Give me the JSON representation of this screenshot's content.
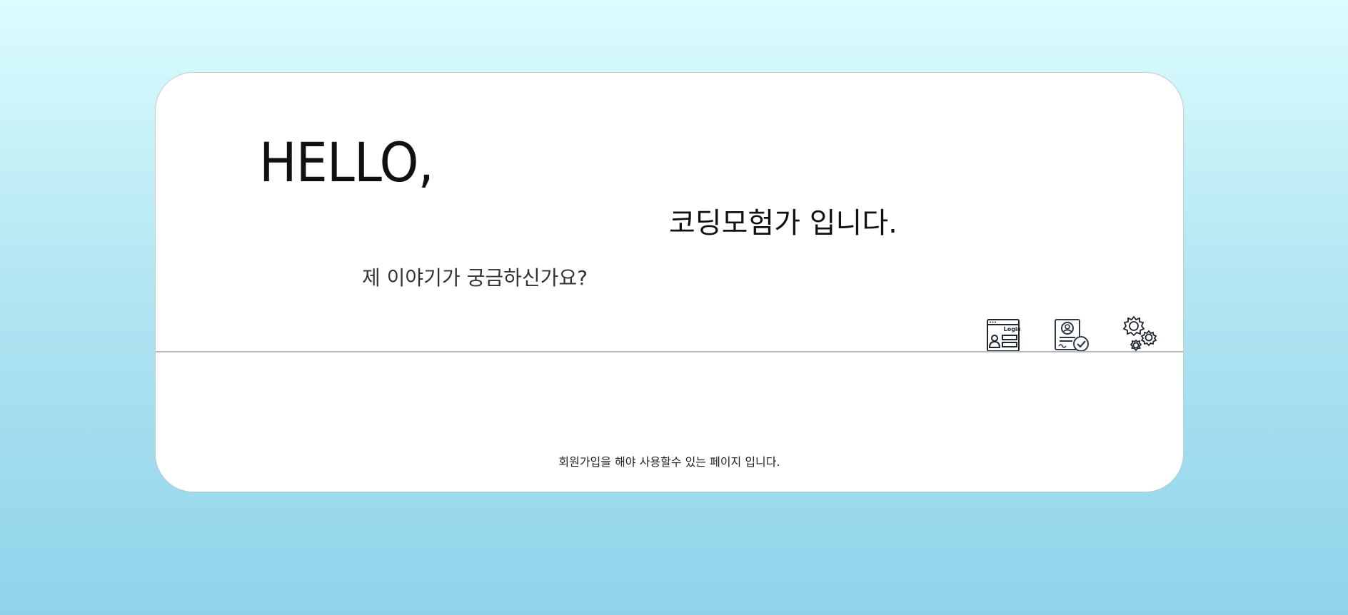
{
  "card": {
    "greeting": "HELLO,",
    "intro": "코딩모험가 입니다.",
    "question": "제 이야기가 궁금하신가요?",
    "footer_note": "회원가입을 해야 사용할수 있는 페이지 입니다."
  },
  "icons": {
    "login": {
      "name": "login-icon",
      "label": "Login"
    },
    "profile": {
      "name": "profile-verified-icon"
    },
    "settings": {
      "name": "settings-gears-icon"
    }
  },
  "colors": {
    "background_top": "#dcfdff",
    "background_bottom": "#8fd3eb",
    "card": "#ffffff",
    "icon_stroke": "#2e3a4a"
  }
}
